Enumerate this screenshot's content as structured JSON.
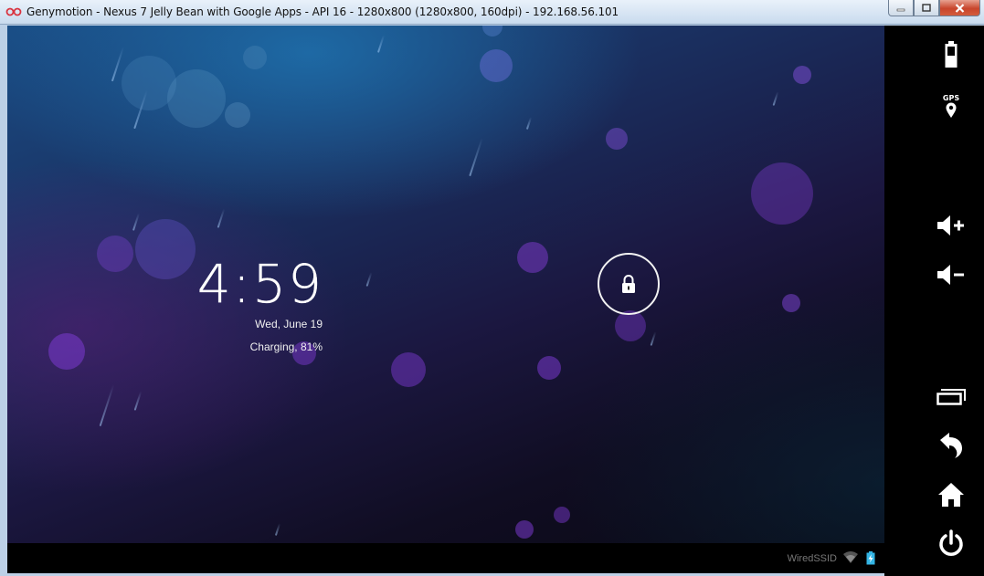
{
  "window": {
    "title": "Genymotion - Nexus 7 Jelly Bean with Google Apps - API 16 - 1280x800 (1280x800, 160dpi) - 192.168.56.101"
  },
  "lockscreen": {
    "time": "4:59",
    "date": "Wed, June 19",
    "charging": "Charging, 81%"
  },
  "statusbar": {
    "ssid": "WiredSSID"
  },
  "sidebar": {
    "gps_label": "GPS",
    "controls": [
      "battery-icon",
      "gps-icon",
      "volume-up-icon",
      "volume-down-icon",
      "recent-apps-icon",
      "back-icon",
      "home-icon",
      "power-icon"
    ]
  },
  "colors": {
    "titlebar": "#c9dbee",
    "close_button": "#c8452c",
    "screen_top": "#1a4c84",
    "screen_bottom": "#080811",
    "bokeh": "#7a3fd0",
    "statusbar_battery": "#33b5e5"
  }
}
